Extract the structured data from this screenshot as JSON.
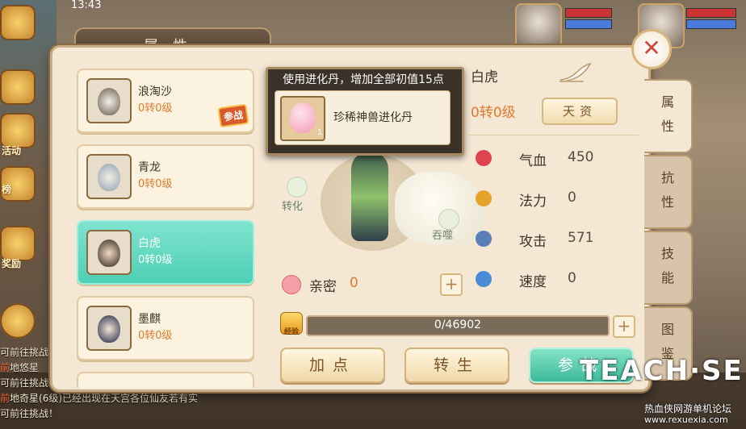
{
  "hud": {
    "clock": "13:43",
    "side_labels": [
      "活动",
      "榜",
      "奖励"
    ],
    "chat_lines": [
      {
        "tag": "",
        "text": "可前往挑战！"
      },
      {
        "tag": "前",
        "text": "地悠星"
      },
      {
        "tag": "",
        "text": "可前往挑战"
      },
      {
        "tag": "前",
        "text": "地奇星(6级)已经出现在天宫各位仙友若有实"
      },
      {
        "tag": "",
        "text": "可前往挑战！"
      }
    ]
  },
  "panel": {
    "title": "属性",
    "pets": [
      {
        "name": "浪淘沙",
        "level": "0转0级",
        "badge": "参战",
        "selected": false
      },
      {
        "name": "青龙",
        "level": "0转0级",
        "badge": "",
        "selected": false
      },
      {
        "name": "白虎",
        "level": "0转0级",
        "badge": "",
        "selected": true
      },
      {
        "name": "墨麒",
        "level": "0转0级",
        "badge": "",
        "selected": false
      }
    ],
    "selected_pet": {
      "name": "白虎",
      "rebirth_level": "0转0级",
      "talent_button": "天资",
      "stats": [
        {
          "label": "气血",
          "value": "450",
          "icon": "heart-icon",
          "color": "#e0424f"
        },
        {
          "label": "法力",
          "value": "0",
          "icon": "mana-icon",
          "color": "#e6a32b"
        },
        {
          "label": "攻击",
          "value": "571",
          "icon": "sword-icon",
          "color": "#5a7fb8"
        },
        {
          "label": "速度",
          "value": "0",
          "icon": "speed-icon",
          "color": "#4a8bd8"
        }
      ],
      "transform_label": "转化",
      "devour_label": "吞噬",
      "intimacy_label": "亲密",
      "intimacy_value": "0",
      "exp_badge": "经验",
      "exp_text": "0/46902",
      "exp_fraction": 0.0
    },
    "tooltip": {
      "title": "使用进化丹，增加全部初值15点",
      "item_name": "珍稀神兽进化丹",
      "item_count": "1"
    },
    "actions": {
      "add_points": "加点",
      "rebirth": "转生",
      "battle": "参战"
    },
    "tabs": [
      "属性",
      "抗性",
      "技能",
      "图鉴"
    ]
  },
  "watermark": {
    "logo": "TEACH·SE",
    "site": "热血侠网游单机论坛",
    "url": "www.rexuexia.com"
  }
}
